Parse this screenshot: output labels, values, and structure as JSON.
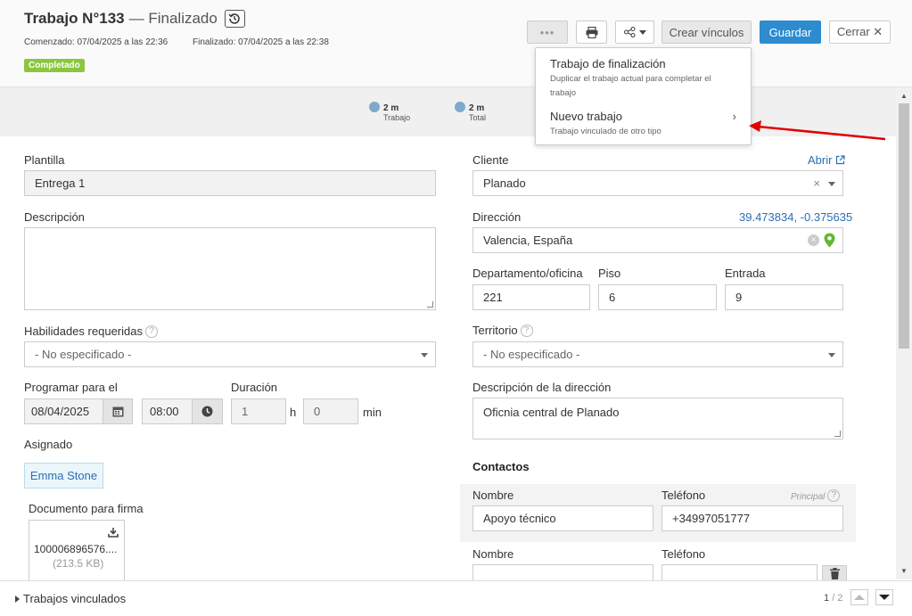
{
  "header": {
    "title": "Trabajo N°133",
    "status": "— Finalizado",
    "started": "Comenzado: 07/04/2025 a las 22:36",
    "finished": "Finalizado: 07/04/2025 a las 22:38",
    "badge": "Completado"
  },
  "toolbar": {
    "more_label": "•••",
    "create_links_label": "Crear vínculos",
    "save_label": "Guardar",
    "close_label": "Cerrar ✕"
  },
  "dropdown": {
    "items": [
      {
        "title": "Trabajo de finalización",
        "subtitle": "Duplicar el trabajo actual para completar el trabajo"
      },
      {
        "title": "Nuevo trabajo",
        "subtitle": "Trabajo vinculado de otro tipo"
      }
    ]
  },
  "times": [
    {
      "value": "2 m",
      "label": "Trabajo"
    },
    {
      "value": "2 m",
      "label": "Total"
    }
  ],
  "left": {
    "template_label": "Plantilla",
    "template_value": "Entrega 1",
    "description_label": "Descripción",
    "skills_label": "Habilidades requeridas",
    "skills_value": "- No especificado -",
    "schedule_label": "Programar para el",
    "date_value": "08/04/2025",
    "time_value": "08:00",
    "duration_label": "Duración",
    "duration_hours": "1",
    "hours_unit": "h",
    "duration_minutes": "0",
    "minutes_unit": "min",
    "assigned_label": "Asignado",
    "assigned_value": "Emma Stone",
    "document_label": "Documento para firma",
    "document_name": "100006896576....",
    "document_size": "(213.5 KB)"
  },
  "right": {
    "client_label": "Cliente",
    "open_link": "Abrir",
    "client_value": "Planado",
    "address_label": "Dirección",
    "coords": "39.473834, -0.375635",
    "address_value": "Valencia, España",
    "apt_label": "Departamento/oficina",
    "apt_value": "221",
    "floor_label": "Piso",
    "floor_value": "6",
    "entrance_label": "Entrada",
    "entrance_value": "9",
    "territory_label": "Territorio",
    "territory_value": "- No especificado -",
    "addr_desc_label": "Descripción de la dirección",
    "addr_desc_value": "Oficnia central de Planado",
    "contacts_label": "Contactos",
    "principal_label": "Principal",
    "contact1": {
      "name_label": "Nombre",
      "name_value": "Apoyo técnico",
      "phone_label": "Teléfono",
      "phone_value": "+34997051777"
    },
    "contact2": {
      "name_label": "Nombre",
      "phone_label": "Teléfono"
    }
  },
  "footer": {
    "linked_jobs": "Trabajos vinculados",
    "page_current": "1",
    "page_total": "/ 2"
  },
  "colors": {
    "primary": "#2d8bd0",
    "badge_green": "#8cc63f",
    "arrow_red": "#e00000",
    "link_blue": "#2a70b3"
  }
}
